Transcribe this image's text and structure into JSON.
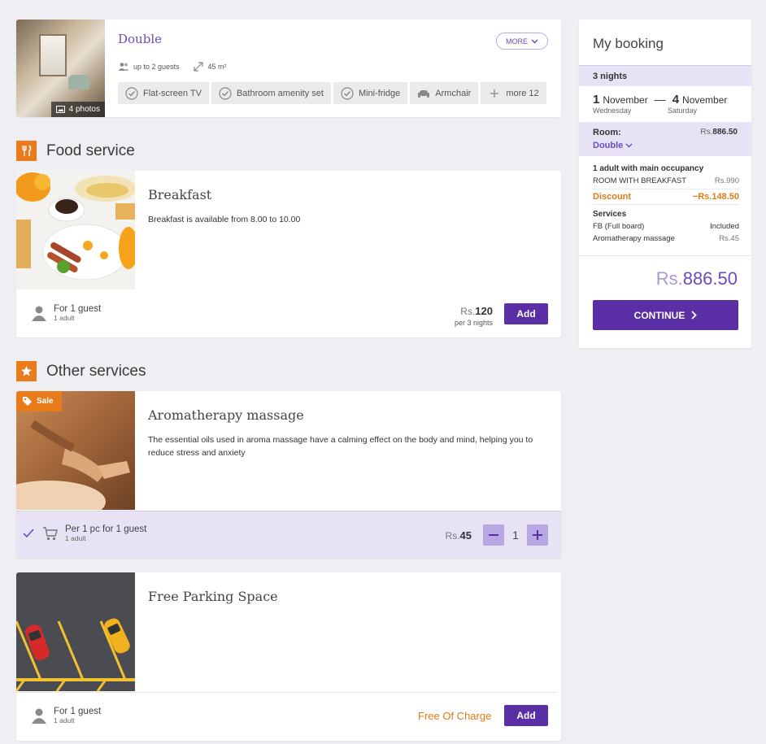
{
  "room": {
    "title": "Double",
    "photos_label": "4 photos",
    "more_label": "MORE",
    "guests": "up to 2 guests",
    "area": "45 m²",
    "amenities": [
      "Flat-screen TV",
      "Bathroom amenity set",
      "Mini-fridge",
      "Armchair"
    ],
    "more_amenities": "more 12"
  },
  "food_section": {
    "title": "Food service",
    "breakfast": {
      "title": "Breakfast",
      "description": "Breakfast is available from 8.00 to 10.00",
      "guest_main": "For 1 guest",
      "guest_sub": "1 adult",
      "currency": "Rs.",
      "price": "120",
      "price_sub": "per 3 nights",
      "add_label": "Add"
    }
  },
  "other_section": {
    "title": "Other services",
    "massage": {
      "badge": "Sale",
      "title": "Aromatherapy massage",
      "description": "The essential oils used in aroma massage have a calming effect on the body and mind, helping you to reduce stress and anxiety",
      "guest_main": "Per 1 pc for 1 guest",
      "guest_sub": "1 adult",
      "currency": "Rs.",
      "price": "45",
      "quantity": "1"
    },
    "parking": {
      "title": "Free Parking Space",
      "guest_main": "For 1 guest",
      "guest_sub": "1 adult",
      "price_label": "Free Of Charge",
      "add_label": "Add"
    }
  },
  "booking": {
    "title": "My booking",
    "nights": "3 nights",
    "check_in_day": "1",
    "check_in_month": "November",
    "check_in_weekday": "Wednesday",
    "dash": "—",
    "check_out_day": "4",
    "check_out_month": "November",
    "check_out_weekday": "Saturday",
    "room_label": "Room:",
    "room_currency": "Rs.",
    "room_price": "886.50",
    "room_type": "Double",
    "occupancy": "1 adult with main occupancy",
    "rate_name": "ROOM WITH BREAKFAST",
    "rate_price": "Rs.990",
    "discount_label": "Discount",
    "discount_value": "−Rs.148.50",
    "services_label": "Services",
    "services": [
      {
        "name": "FB (Full board)",
        "value": "Included"
      },
      {
        "name": "Aromatherapy massage",
        "value": "Rs.45"
      }
    ],
    "total_currency": "Rs.",
    "total": "886.50",
    "continue_label": "CONTINUE"
  },
  "colors": {
    "accent": "#5a2fa6",
    "accent_light": "#e8e3f4",
    "orange": "#e97b1b"
  }
}
